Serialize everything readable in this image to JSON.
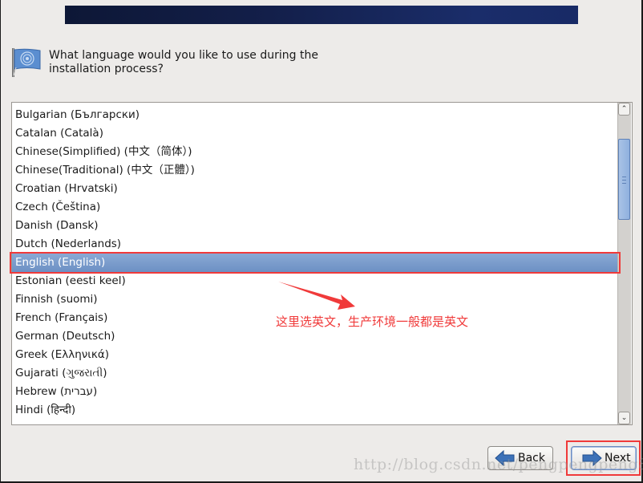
{
  "header": {
    "question": "What language would you like to use during the installation process?",
    "icon": "language-flag-icon"
  },
  "language_list": {
    "selected_index": 8,
    "items": [
      {
        "label": "Bulgarian (Български)"
      },
      {
        "label": "Catalan (Català)"
      },
      {
        "label": "Chinese(Simplified) (中文（简体）)"
      },
      {
        "label": "Chinese(Traditional) (中文（正體）)"
      },
      {
        "label": "Croatian (Hrvatski)"
      },
      {
        "label": "Czech (Čeština)"
      },
      {
        "label": "Danish (Dansk)"
      },
      {
        "label": "Dutch (Nederlands)"
      },
      {
        "label": "English (English)"
      },
      {
        "label": "Estonian (eesti keel)"
      },
      {
        "label": "Finnish (suomi)"
      },
      {
        "label": "French (Français)"
      },
      {
        "label": "German (Deutsch)"
      },
      {
        "label": "Greek (Ελληνικά)"
      },
      {
        "label": "Gujarati (ગુજરાતી)"
      },
      {
        "label": "Hebrew (עברית)"
      },
      {
        "label": "Hindi (हिन्दी)"
      }
    ],
    "scrollbar": {
      "up_icon": "^",
      "down_icon": "v"
    }
  },
  "annotation": {
    "text": "这里选英文，生产环境一般都是英文",
    "color": "#f03a3a"
  },
  "buttons": {
    "back_label": "Back",
    "next_label": "Next"
  },
  "watermark": "http://blog.csdn.net/pengpengpeng85",
  "colors": {
    "selection": "#6c90c4",
    "background": "#edebe9",
    "banner": "#182a66"
  }
}
